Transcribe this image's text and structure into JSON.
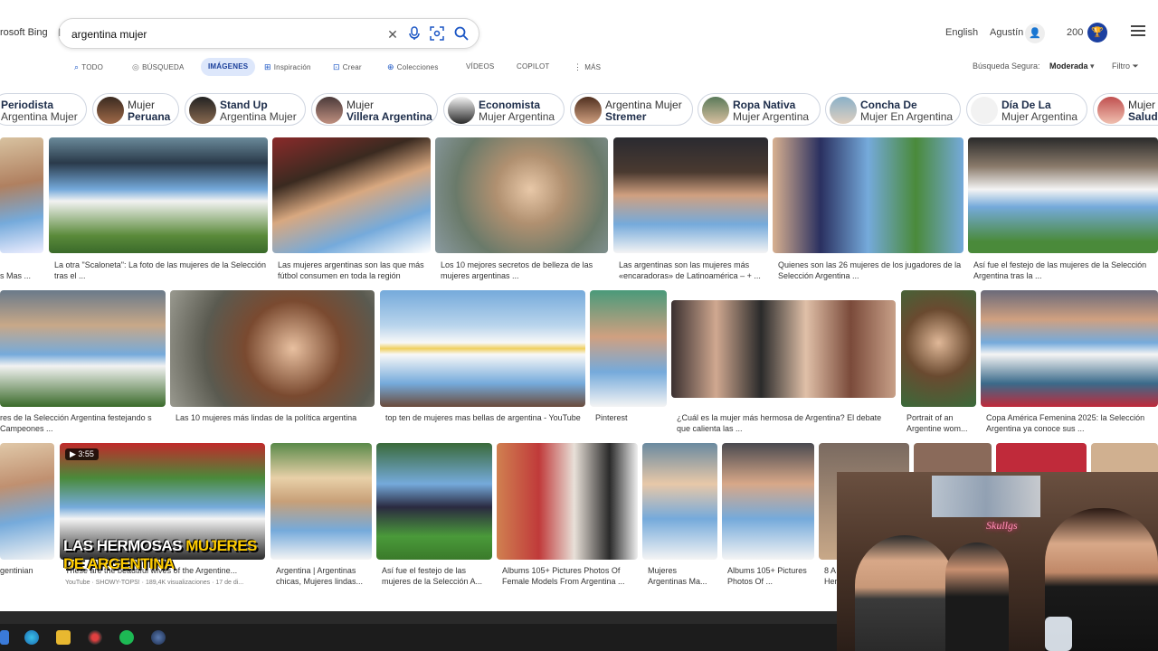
{
  "header": {
    "brand": "rosoft Bing",
    "search_value": "argentina mujer",
    "language": "English",
    "user_name": "Agustín",
    "points": "200"
  },
  "nav": {
    "items": [
      "TODO",
      "BÚSQUEDA",
      "IMÁGENES",
      "Inspiración",
      "Crear",
      "Colecciones",
      "VÍDEOS",
      "COPILOT",
      "MÁS"
    ],
    "safe_search_label": "Búsqueda Segura:",
    "safe_search_value": "Moderada",
    "filter_label": "Filtro"
  },
  "chips": [
    {
      "line1": "Periodista",
      "line2": "Argentina Mujer",
      "bold": 1
    },
    {
      "line1": "Mujer",
      "line2": "Peruana",
      "bold": 2
    },
    {
      "line1": "Stand Up",
      "line2": "Argentina Mujer",
      "bold": 1
    },
    {
      "line1": "Mujer",
      "line2": "Villera Argentina",
      "bold": 2
    },
    {
      "line1": "Economista",
      "line2": "Mujer Argentina",
      "bold": 1
    },
    {
      "line1": "Argentina Mujer",
      "line2": "Stremer",
      "bold": 2
    },
    {
      "line1": "Ropa Nativa",
      "line2": "Mujer Argentina",
      "bold": 1
    },
    {
      "line1": "Concha De",
      "line2": "Mujer En Argentina",
      "bold": 1
    },
    {
      "line1": "Día De La",
      "line2": "Mujer Argentina",
      "bold": 1
    },
    {
      "line1": "Mujer",
      "line2": "Salud",
      "bold": 2
    }
  ],
  "results": {
    "row1": [
      {
        "caption": "s Mas ..."
      },
      {
        "caption": "La otra \"Scaloneta\": La foto de las mujeres de la Selección tras el ..."
      },
      {
        "caption": "Las mujeres argentinas son las que más fútbol consumen en toda la región"
      },
      {
        "caption": "Los 10 mejores secretos de belleza de las mujeres argentinas ..."
      },
      {
        "caption": "Las argentinas son las mujeres más «encaradoras» de Latinoamérica – + ..."
      },
      {
        "caption": "Quienes son las 26 mujeres de los jugadores de la Selección Argentina ..."
      },
      {
        "caption": "Así fue el festejo de las mujeres de la Selección Argentina tras la ..."
      }
    ],
    "row2": [
      {
        "caption": "res de la Selección Argentina festejando s Campeones ..."
      },
      {
        "caption": "Las 10 mujeres más lindas de la política argentina"
      },
      {
        "caption": "top ten de mujeres mas bellas de argentina - YouTube"
      },
      {
        "caption": "Pinterest"
      },
      {
        "caption": "¿Cuál es la mujer más hermosa de Argentina? El debate que calienta las ..."
      },
      {
        "caption": "Portrait of an Argentine wom..."
      },
      {
        "caption": "Copa América Femenina 2025: la Selección Argentina ya conoce sus ..."
      }
    ],
    "row3": [
      {
        "caption": "gentinian"
      },
      {
        "caption": "These are the beautiful wives of the Argentine...",
        "sub": "YouTube · SHOWY-TOPS! · 189,4K visualizaciones · 17 de di..."
      },
      {
        "caption": "Argentina | Argentinas chicas, Mujeres lindas..."
      },
      {
        "caption": "Así fue el festejo de las mujeres de la Selección A..."
      },
      {
        "caption": "Albums 105+ Pictures Photos Of Female Models From Argentina ..."
      },
      {
        "caption": "Mujeres Argentinas Ma..."
      },
      {
        "caption": "Albums 105+ Pictures Photos Of ..."
      },
      {
        "caption": "8 A Her..."
      }
    ],
    "video_duration": "3:55",
    "video_overlay_prefix": "LAS HERMOSAS",
    "video_overlay_mid": "MUJERES DE",
    "video_overlay_suffix": "ARGENTINA"
  },
  "overlay": {
    "neon_sign": "Skullgs"
  },
  "colors": {
    "accent": "#1a55c4",
    "nav_active_bg": "#dde7fb",
    "argentina_blue": "#75aadb",
    "taskbar": "#1c1c1c"
  }
}
